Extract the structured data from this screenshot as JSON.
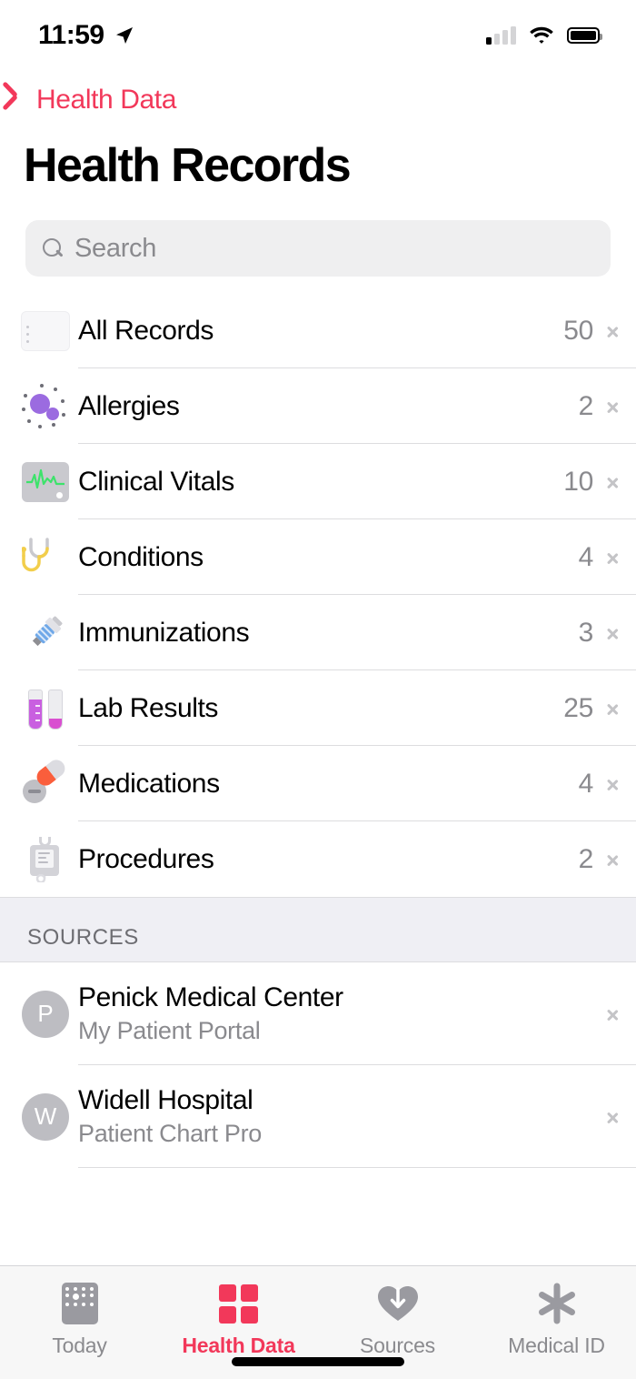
{
  "status_bar": {
    "time": "11:59",
    "location_icon": "location-arrow-icon",
    "signal_icon": "cellular-signal-icon",
    "signal_bars_filled": 1,
    "wifi_icon": "wifi-icon",
    "battery_icon": "battery-full-icon"
  },
  "nav": {
    "back_label": "Health Data",
    "back_icon": "chevron-left-icon",
    "accent_color": "#F2385A"
  },
  "page_title": "Health Records",
  "search": {
    "placeholder": "Search",
    "value": "",
    "icon": "search-icon"
  },
  "records": [
    {
      "label": "All Records",
      "count": "50",
      "icon": "records-document-icon"
    },
    {
      "label": "Allergies",
      "count": "2",
      "icon": "allergies-particles-icon"
    },
    {
      "label": "Clinical Vitals",
      "count": "10",
      "icon": "vitals-monitor-icon"
    },
    {
      "label": "Conditions",
      "count": "4",
      "icon": "stethoscope-icon"
    },
    {
      "label": "Immunizations",
      "count": "3",
      "icon": "syringe-icon"
    },
    {
      "label": "Lab Results",
      "count": "25",
      "icon": "test-tubes-icon"
    },
    {
      "label": "Medications",
      "count": "4",
      "icon": "pills-icon"
    },
    {
      "label": "Procedures",
      "count": "2",
      "icon": "iv-bag-icon"
    }
  ],
  "sources": {
    "header": "SOURCES",
    "items": [
      {
        "initial": "P",
        "name": "Penick Medical Center",
        "subtitle": "My Patient Portal"
      },
      {
        "initial": "W",
        "name": "Widell Hospital",
        "subtitle": "Patient Chart Pro"
      }
    ]
  },
  "tabbar": {
    "tabs": [
      {
        "label": "Today",
        "icon": "calendar-icon",
        "active": false
      },
      {
        "label": "Health Data",
        "icon": "health-data-icon",
        "active": true
      },
      {
        "label": "Sources",
        "icon": "heart-download-icon",
        "active": false
      },
      {
        "label": "Medical ID",
        "icon": "medical-id-asterisk-icon",
        "active": false
      }
    ]
  }
}
